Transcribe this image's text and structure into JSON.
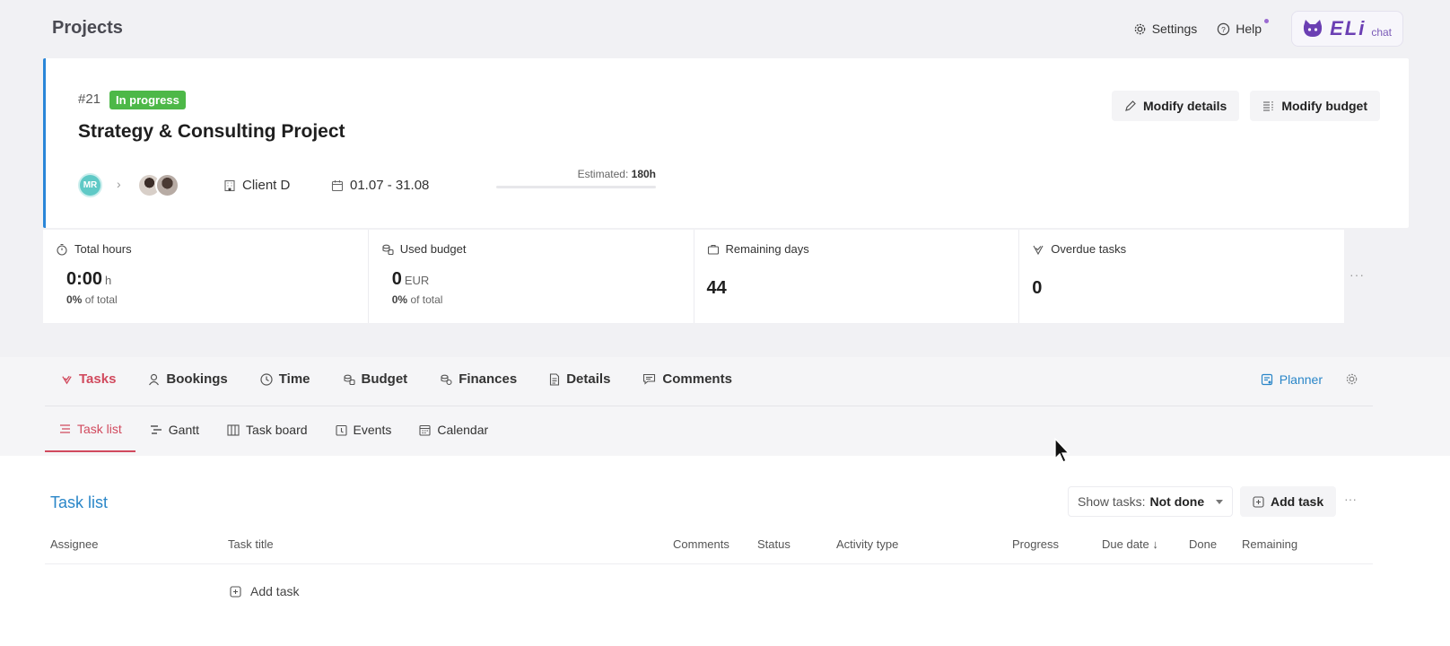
{
  "page": {
    "title": "Projects"
  },
  "header": {
    "settings": "Settings",
    "help": "Help",
    "eli_logo": "ELi",
    "eli_chat": "chat"
  },
  "project": {
    "id": "#21",
    "status": "In progress",
    "status_color": "#4db848",
    "name": "Strategy & Consulting Project",
    "owner_initials": "MR",
    "client": "Client D",
    "dates": "01.07 - 31.08",
    "estimated_label": "Estimated:",
    "estimated_value": "180h",
    "modify_details": "Modify details",
    "modify_budget": "Modify budget"
  },
  "stats": {
    "total_hours": {
      "label": "Total hours",
      "value": "0:00",
      "unit": "h",
      "pct": "0%",
      "sub": "of total"
    },
    "used_budget": {
      "label": "Used budget",
      "value": "0",
      "unit": "EUR",
      "pct": "0%",
      "sub": "of total"
    },
    "remaining_days": {
      "label": "Remaining days",
      "value": "44"
    },
    "overdue_tasks": {
      "label": "Overdue tasks",
      "value": "0"
    },
    "more": "···"
  },
  "tabs": {
    "main": [
      "Tasks",
      "Bookings",
      "Time",
      "Budget",
      "Finances",
      "Details",
      "Comments"
    ],
    "active_main": "Tasks",
    "planner": "Planner",
    "sub": [
      "Task list",
      "Gantt",
      "Task board",
      "Events",
      "Calendar"
    ],
    "active_sub": "Task list"
  },
  "task_list": {
    "title": "Task list",
    "show_tasks_label": "Show tasks:",
    "show_tasks_value": "Not done",
    "add_task": "Add task",
    "more": "···",
    "columns": [
      "Assignee",
      "Task title",
      "Comments",
      "Status",
      "Activity type",
      "Progress",
      "Due date ↓",
      "Done",
      "Remaining"
    ],
    "add_row": "Add task"
  },
  "colors": {
    "accent_red": "#d14a5e",
    "accent_blue": "#2a86c8",
    "border_blue": "#2a86d8"
  }
}
